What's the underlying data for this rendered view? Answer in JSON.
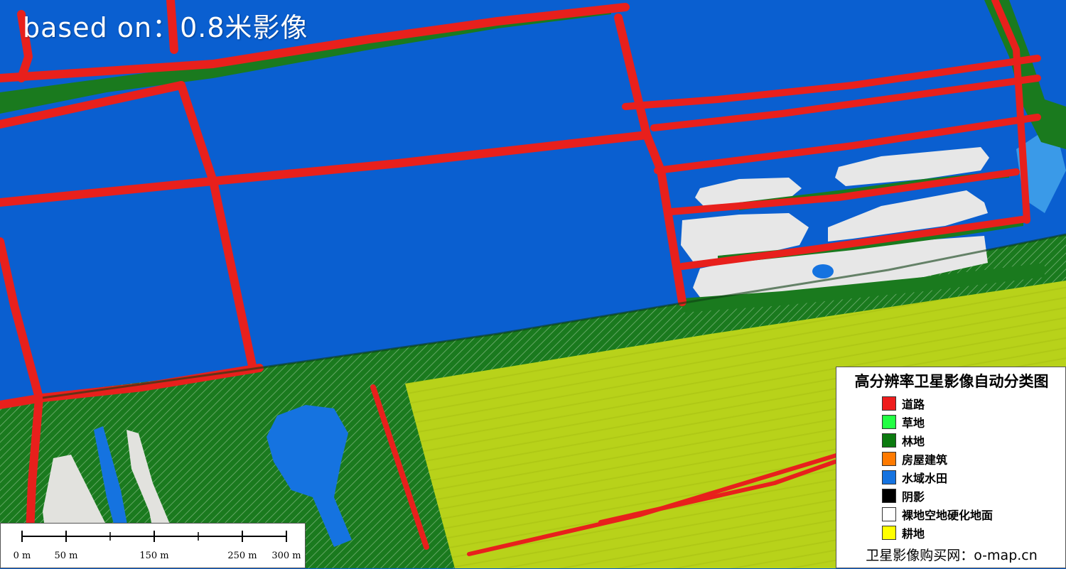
{
  "overlay": {
    "based_on": "based on：0.8米影像"
  },
  "legend": {
    "title": "高分辨率卫星影像自动分类图",
    "items": [
      {
        "label": "道路",
        "color": "#ee1c1c"
      },
      {
        "label": "草地",
        "color": "#22ff44"
      },
      {
        "label": "林地",
        "color": "#0b7a0f"
      },
      {
        "label": "房屋建筑",
        "color": "#ff7a00"
      },
      {
        "label": "水域水田",
        "color": "#1573e0"
      },
      {
        "label": "阴影",
        "color": "#000000"
      },
      {
        "label": "裸地空地硬化地面",
        "color": "#ffffff"
      },
      {
        "label": "耕地",
        "color": "#ffff00"
      }
    ],
    "footer": "卫星影像购买网：o-map.cn"
  },
  "scalebar": {
    "ticks": [
      {
        "label": "0 m",
        "value": 0
      },
      {
        "label": "50 m",
        "value": 50
      },
      {
        "label": "150 m",
        "value": 150
      },
      {
        "label": "250 m",
        "value": 250
      },
      {
        "label": "300 m",
        "value": 300
      }
    ]
  },
  "colors": {
    "water": "#0a5fd0",
    "road": "#e8201c",
    "forest": "#1a7a1e",
    "farmland": "#b8d21a",
    "bare": "#e6e6e6"
  }
}
